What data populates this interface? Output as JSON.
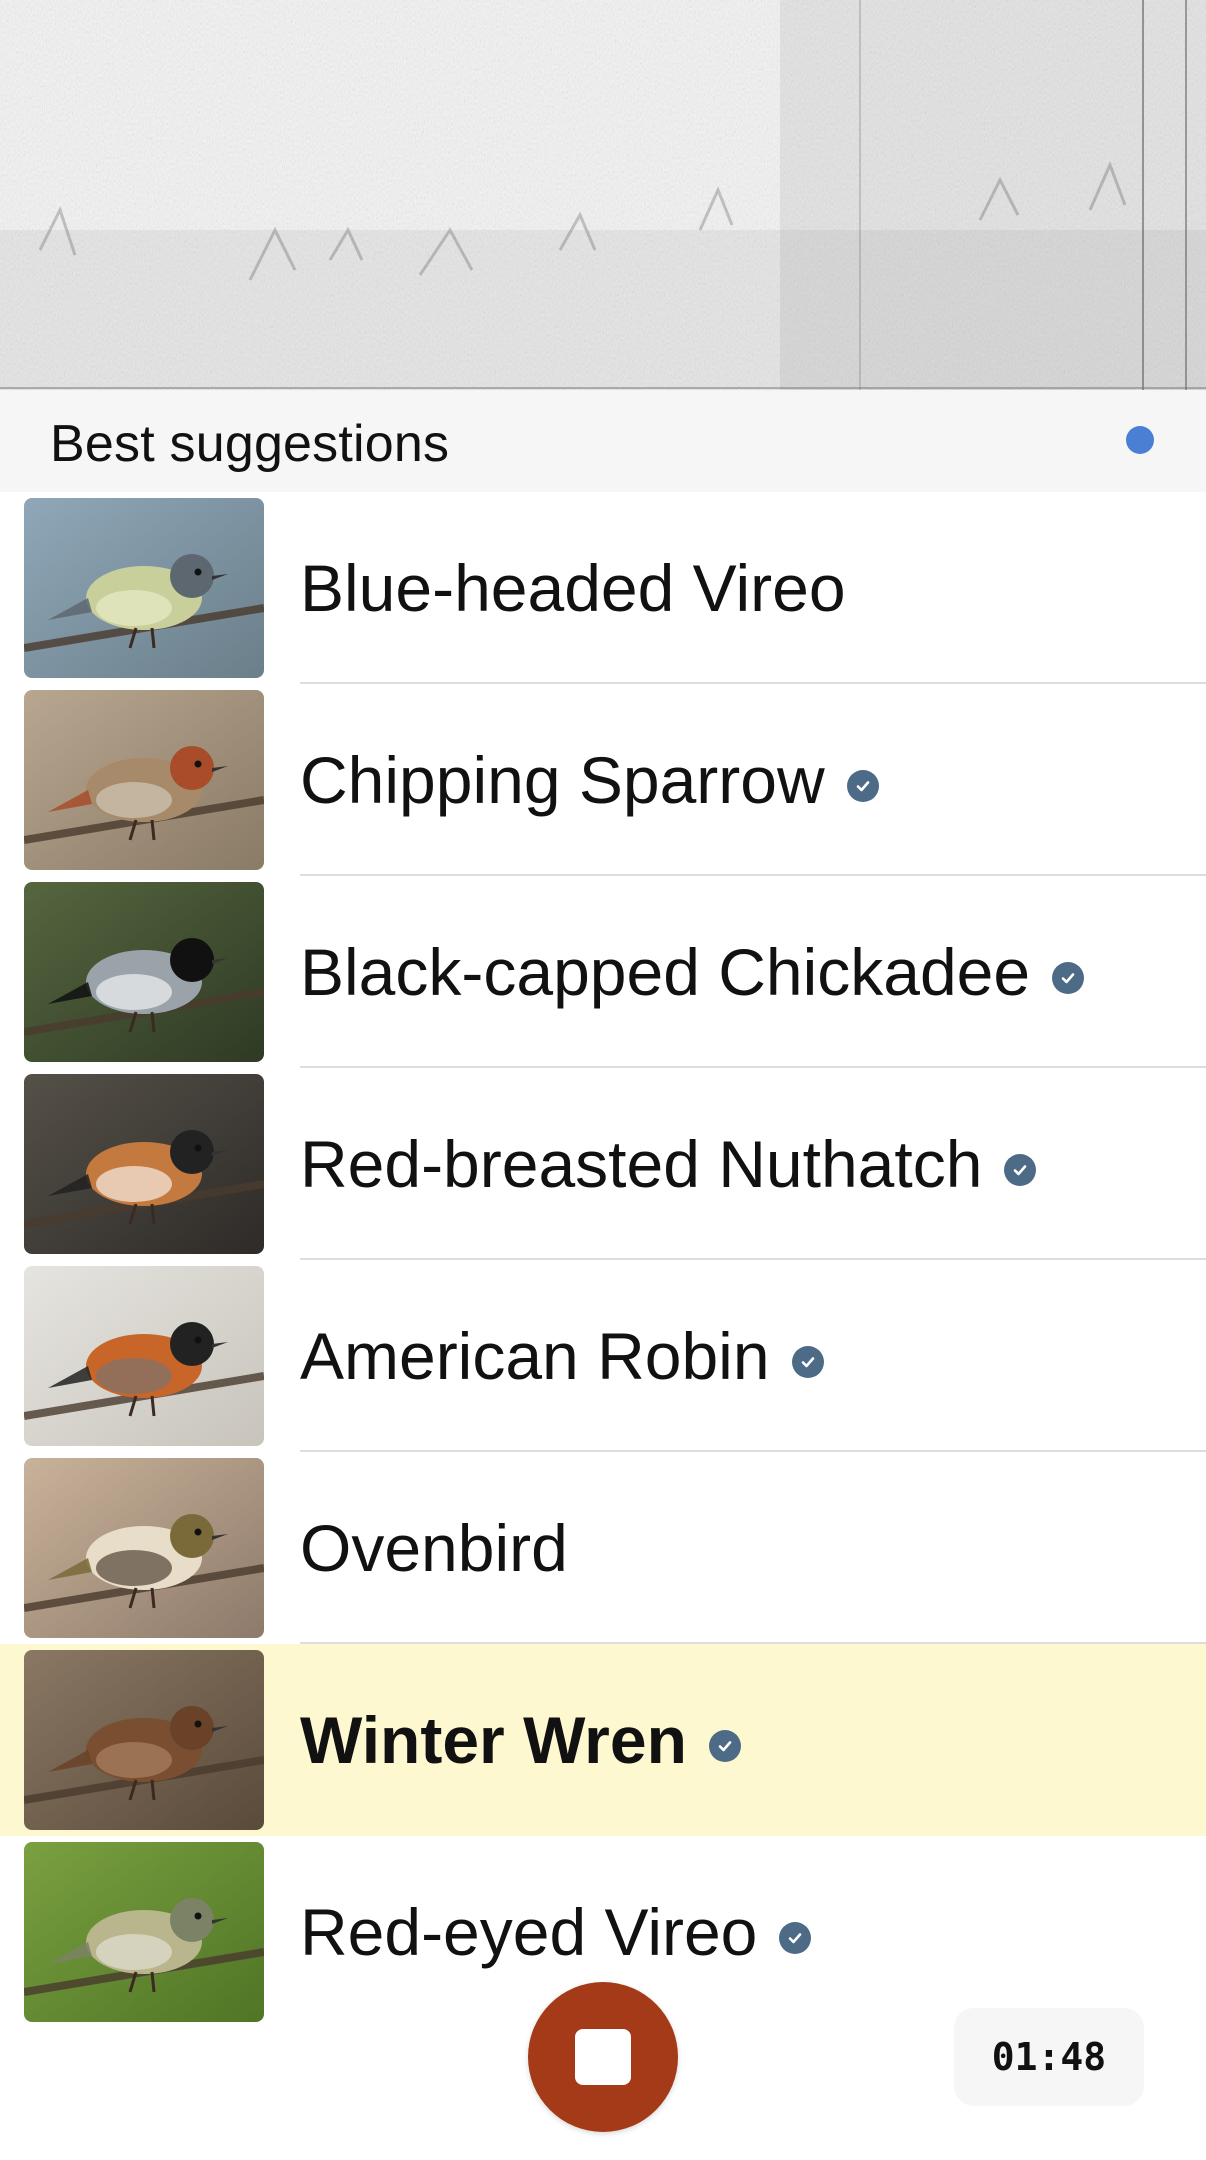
{
  "section": {
    "title": "Best suggestions"
  },
  "status_dot": {
    "color": "#4a7fd4"
  },
  "species": [
    {
      "name": "Blue-headed Vireo",
      "verified": false,
      "highlight": false,
      "photo_icon": "blue-headed-vireo-photo"
    },
    {
      "name": "Chipping Sparrow",
      "verified": true,
      "highlight": false,
      "photo_icon": "chipping-sparrow-photo"
    },
    {
      "name": "Black-capped Chickadee",
      "verified": true,
      "highlight": false,
      "photo_icon": "black-capped-chickadee-photo"
    },
    {
      "name": "Red-breasted Nuthatch",
      "verified": true,
      "highlight": false,
      "photo_icon": "red-breasted-nuthatch-photo"
    },
    {
      "name": "American Robin",
      "verified": true,
      "highlight": false,
      "photo_icon": "american-robin-photo"
    },
    {
      "name": "Ovenbird",
      "verified": false,
      "highlight": false,
      "photo_icon": "ovenbird-photo"
    },
    {
      "name": "Winter Wren",
      "verified": true,
      "highlight": true,
      "photo_icon": "winter-wren-photo"
    },
    {
      "name": "Red-eyed Vireo",
      "verified": true,
      "highlight": false,
      "photo_icon": "red-eyed-vireo-photo"
    }
  ],
  "controls": {
    "stop_icon": "stop-icon",
    "timer": "01:48"
  },
  "colors": {
    "highlight": "#fdf8cf",
    "verified_badge": "#4d6b87",
    "stop_button": "#a53a18"
  }
}
